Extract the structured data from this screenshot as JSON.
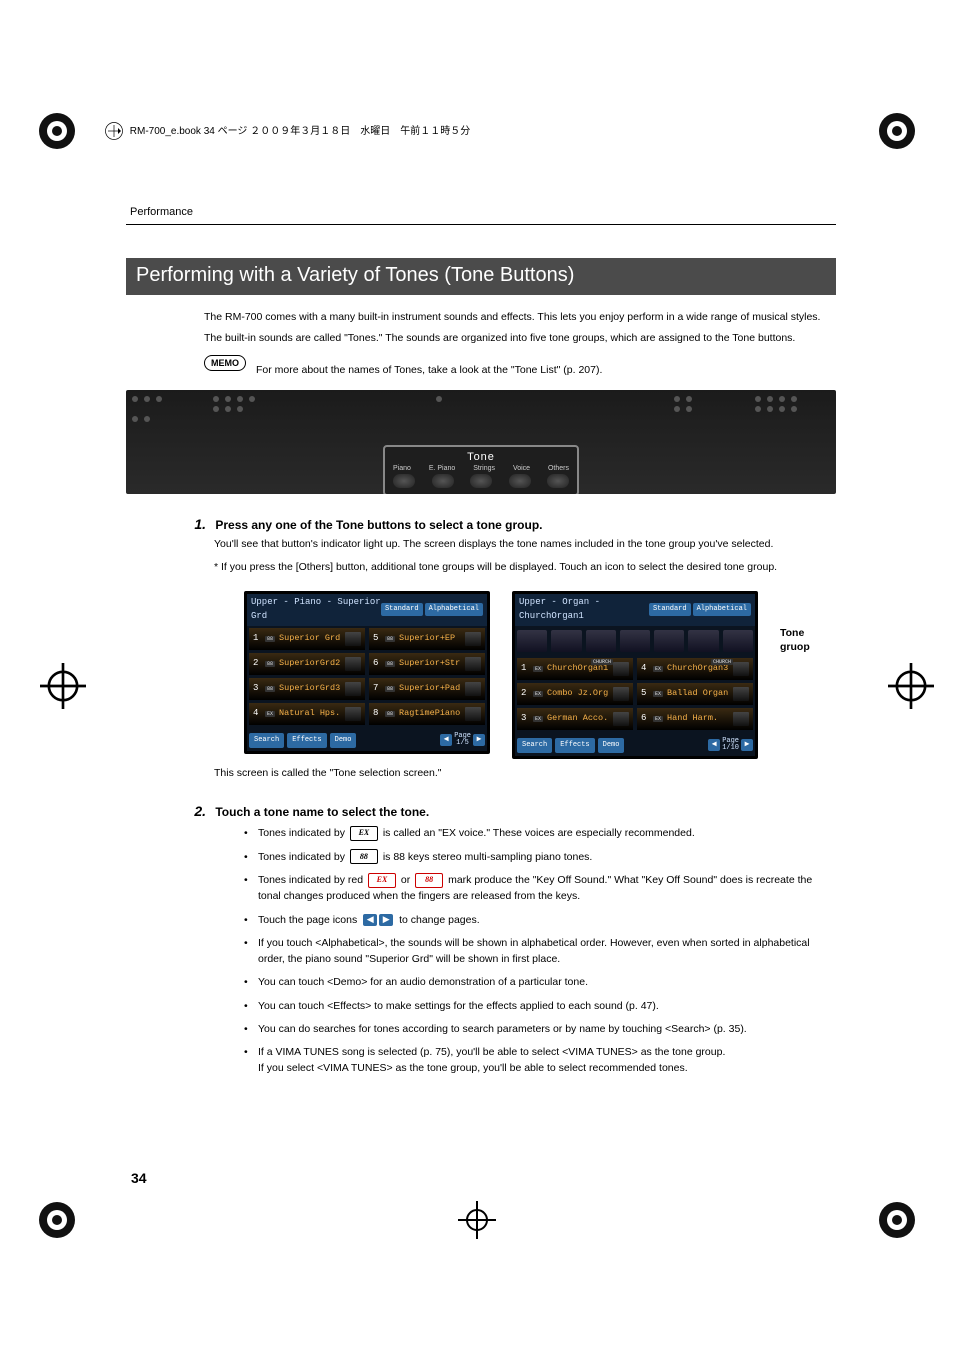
{
  "meta": {
    "header": "RM-700_e.book  34 ページ  ２００９年３月１８日　水曜日　午前１１時５分"
  },
  "running_head": "Performance",
  "title": "Performing with a Variety of Tones (Tone Buttons)",
  "intro1": "The RM-700 comes with a many built-in instrument sounds and effects. This lets you enjoy perform in a wide range of musical styles.",
  "intro2": "The built-in sounds are called \"Tones.\" The sounds are organized into five tone groups, which are assigned to the Tone buttons.",
  "memo_label": "MEMO",
  "memo_text": "For more about the names of Tones, take a look at the \"Tone List\" (p. 207).",
  "panel": {
    "tone_title": "Tone",
    "buttons": [
      "Piano",
      "E. Piano",
      "Strings",
      "Voice",
      "Others"
    ]
  },
  "step1": {
    "num": "1.",
    "head": "Press any one of the Tone buttons to select a tone group.",
    "line1": "You'll see that button's indicator light up. The screen displays the tone names included in the tone group you've selected.",
    "line2": "*  If you press the [Others] button, additional tone groups will be displayed. Touch an icon to select the desired tone group."
  },
  "screens_label": "Tone gruop",
  "screens_caption": "This screen is called the \"Tone selection screen.\"",
  "screenA": {
    "title": "Upper - Piano - Superior Grd",
    "chips": [
      "Standard",
      "Alphabetical"
    ],
    "tones": [
      {
        "n": "1",
        "tag": "88",
        "name": "Superior Grd"
      },
      {
        "n": "5",
        "tag": "88",
        "name": "Superior+EP"
      },
      {
        "n": "2",
        "tag": "88",
        "name": "SuperiorGrd2"
      },
      {
        "n": "6",
        "tag": "88",
        "name": "Superior+Str"
      },
      {
        "n": "3",
        "tag": "88",
        "name": "SuperiorGrd3"
      },
      {
        "n": "7",
        "tag": "88",
        "name": "Superior+Pad"
      },
      {
        "n": "4",
        "tag": "EX",
        "name": "Natural Hps."
      },
      {
        "n": "8",
        "tag": "88",
        "name": "RagtimePiano"
      }
    ],
    "bottom": [
      "Search",
      "Effects",
      "Demo"
    ],
    "page": "Page\n1/5"
  },
  "screenB": {
    "title": "Upper - Organ - ChurchOrgan1",
    "chips": [
      "Standard",
      "Alphabetical"
    ],
    "tones": [
      {
        "n": "1",
        "tag": "EX",
        "name": "ChurchOrgan1",
        "corner": "CHURCH"
      },
      {
        "n": "4",
        "tag": "EX",
        "name": "ChurchOrgan3",
        "corner": "CHURCH"
      },
      {
        "n": "2",
        "tag": "EX",
        "name": "Combo Jz.Org"
      },
      {
        "n": "5",
        "tag": "EX",
        "name": "Ballad Organ"
      },
      {
        "n": "3",
        "tag": "EX",
        "name": "German Acco."
      },
      {
        "n": "6",
        "tag": "EX",
        "name": "Hand Harm."
      }
    ],
    "bottom": [
      "Search",
      "Effects",
      "Demo"
    ],
    "page": "Page\n1/10"
  },
  "step2": {
    "num": "2.",
    "head": "Touch a tone name to select the tone.",
    "bullets": {
      "b1a": "Tones indicated by ",
      "b1b": " is called an \"EX voice.\" These voices are especially recommended.",
      "b2a": "Tones indicated by ",
      "b2b": " is 88 keys stereo multi-sampling piano tones.",
      "b3a": "Tones indicated by red ",
      "b3b": " or ",
      "b3c": " mark produce the \"Key Off Sound.\" What \"Key Off Sound\" does is recreate the tonal changes produced when the fingers are released from the keys.",
      "b4a": "Touch the page icons ",
      "b4b": " to change pages.",
      "b5": "If you touch <Alphabetical>, the sounds will be shown in alphabetical order. However, even when sorted in alphabetical order, the piano sound \"Superior Grd\" will be shown in first place.",
      "b6": "You can touch <Demo> for an audio demonstration of a particular tone.",
      "b7": "You can touch <Effects> to make settings for the effects applied to each sound (p. 47).",
      "b8": "You can do searches for tones according to search parameters or by name by touching <Search> (p. 35).",
      "b9": "If a VIMA TUNES song is selected (p. 75), you'll be able to select <VIMA TUNES> as the tone group.\nIf you select <VIMA TUNES> as the tone group, you'll be able to select recommended tones."
    },
    "badge_ex": "EX",
    "badge_88": "88"
  },
  "page_number": "34"
}
